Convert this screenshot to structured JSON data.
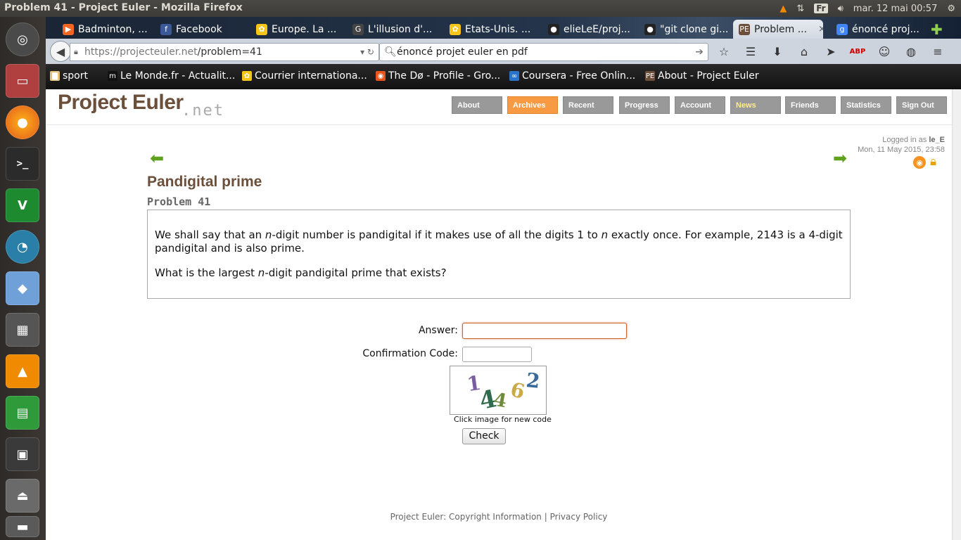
{
  "window": {
    "title": "Problem 41 - Project Euler - Mozilla Firefox"
  },
  "tray": {
    "lang": "Fr",
    "datetime": "mar. 12 mai 00:57"
  },
  "tabs": [
    {
      "label": "Badminton, ...",
      "fav_color": "#f26522",
      "fav_glyph": "▶"
    },
    {
      "label": "Facebook",
      "fav_color": "#3b5998",
      "fav_glyph": "f"
    },
    {
      "label": "Europe. La ...",
      "fav_color": "#f5c518",
      "fav_glyph": "✿"
    },
    {
      "label": "L'illusion d'...",
      "fav_color": "#444",
      "fav_glyph": "G"
    },
    {
      "label": "Etats-Unis. ...",
      "fav_color": "#f5c518",
      "fav_glyph": "✿"
    },
    {
      "label": "elieLeE/proj...",
      "fav_color": "#222",
      "fav_glyph": "●"
    },
    {
      "label": "\"git clone gi...",
      "fav_color": "#222",
      "fav_glyph": "●"
    },
    {
      "label": "Problem ...",
      "fav_color": "#6b4f3a",
      "fav_glyph": "PE",
      "active": true,
      "close": "×"
    },
    {
      "label": "énoncé proj...",
      "fav_color": "#4285f4",
      "fav_glyph": "g"
    }
  ],
  "navbar": {
    "url_host": "https://projecteuler.net",
    "url_path": "/problem=41",
    "search_value": "énoncé projet euler en pdf"
  },
  "bookmarks": [
    {
      "label": "sport",
      "fav_color": "#e8c07a",
      "fav_glyph": "▇"
    },
    {
      "label": "Le Monde.fr - Actualit...",
      "fav_color": "#111",
      "fav_glyph": "m"
    },
    {
      "label": "Courrier internationa...",
      "fav_color": "#f5c518",
      "fav_glyph": "✿"
    },
    {
      "label": "The Dø - Profile - Gro...",
      "fav_color": "#e8541e",
      "fav_glyph": "◉"
    },
    {
      "label": "Coursera - Free Onlin...",
      "fav_color": "#2a73cc",
      "fav_glyph": "∞"
    },
    {
      "label": "About - Project Euler",
      "fav_color": "#6b4f3a",
      "fav_glyph": "PE"
    }
  ],
  "site": {
    "logo": "Project Euler",
    "logo_suffix": ".net",
    "nav": [
      "About",
      "Archives",
      "Recent",
      "Progress",
      "Account",
      "News",
      "Friends",
      "Statistics",
      "Sign Out"
    ],
    "logged_in_prefix": "Logged in as",
    "user": "le_E",
    "date": "Mon, 11 May 2015, 23:58"
  },
  "problem": {
    "title": "Pandigital prime",
    "number": "Problem 41",
    "p1_a": "We shall say that an ",
    "p1_n1": "n",
    "p1_b": "-digit number is pandigital if it makes use of all the digits 1 to ",
    "p1_n2": "n",
    "p1_c": " exactly once. For example, 2143 is a 4-digit pandigital and is also prime.",
    "p2_a": "What is the largest ",
    "p2_n": "n",
    "p2_b": "-digit pandigital prime that exists?"
  },
  "form": {
    "answer_label": "Answer:",
    "answer_value": "",
    "conf_label": "Confirmation Code:",
    "conf_value": "",
    "captcha_digits": [
      "1",
      "4",
      "4",
      "6",
      "2"
    ],
    "captcha_caption": "Click image for new code",
    "check_label": "Check"
  },
  "footer": {
    "prefix": "Project Euler:",
    "copyright": "Copyright Information",
    "sep": "|",
    "privacy": "Privacy Policy"
  }
}
